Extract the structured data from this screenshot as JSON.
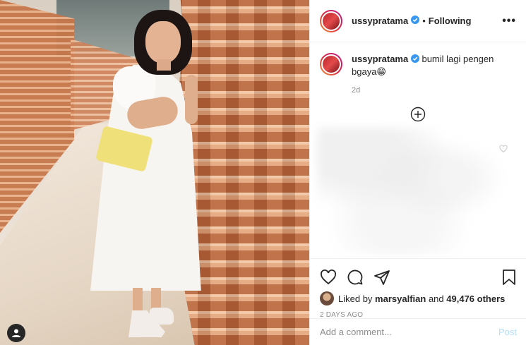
{
  "post": {
    "username": "ussypratama",
    "follow_separator": "•",
    "follow_label": "Following",
    "more_label": "•••",
    "caption_text": "bumil lagi pengen bgaya",
    "caption_emoji": "😁",
    "caption_time": "2d",
    "likes_prefix": "Liked by",
    "likes_user": "marsyalfian",
    "likes_joiner": "and",
    "likes_count": "49,476 others",
    "posted_ago": "2 DAYS AGO",
    "comment_placeholder": "Add a comment...",
    "post_button_label": "Post"
  },
  "icons": {
    "verified": "verified-badge-icon",
    "load_more": "plus-circle-icon",
    "like": "heart-icon",
    "comment": "comment-icon",
    "share": "paper-plane-icon",
    "save": "bookmark-icon",
    "user": "user-icon"
  },
  "colors": {
    "verified_blue": "#3897f0",
    "post_disabled": "#b2dffc",
    "muted_text": "#8e8e8e"
  }
}
